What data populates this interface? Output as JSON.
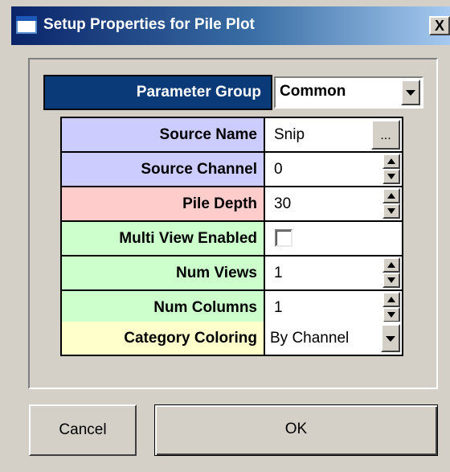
{
  "window": {
    "title": "Setup Properties for Pile Plot",
    "close_label": "X"
  },
  "parameter_group": {
    "label": "Parameter Group",
    "value": "Common"
  },
  "properties": [
    {
      "label": "Source Name",
      "value": "Snip",
      "control": "ellipsis",
      "color": "#ccccff"
    },
    {
      "label": "Source Channel",
      "value": "0",
      "control": "spin",
      "color": "#ccccff"
    },
    {
      "label": "Pile Depth",
      "value": "30",
      "control": "spin",
      "color": "#ffcccc"
    },
    {
      "label": "Multi View Enabled",
      "value": "",
      "control": "checkbox",
      "checked": false,
      "color": "#ccffcc"
    },
    {
      "label": "Num Views",
      "value": "1",
      "control": "spin",
      "color": "#ccffcc"
    },
    {
      "label": "Num Columns",
      "value": "1",
      "control": "spin",
      "color": "#ccffcc"
    },
    {
      "label": "Category Coloring",
      "value": "By Channel",
      "control": "dropdown",
      "color": "#ffffcc"
    }
  ],
  "ellipsis_label": "...",
  "buttons": {
    "cancel": "Cancel",
    "ok": "OK"
  },
  "colors": {
    "parameter_group_bg": "#0a3a78",
    "dialog_bg": "#d4d0c8"
  }
}
